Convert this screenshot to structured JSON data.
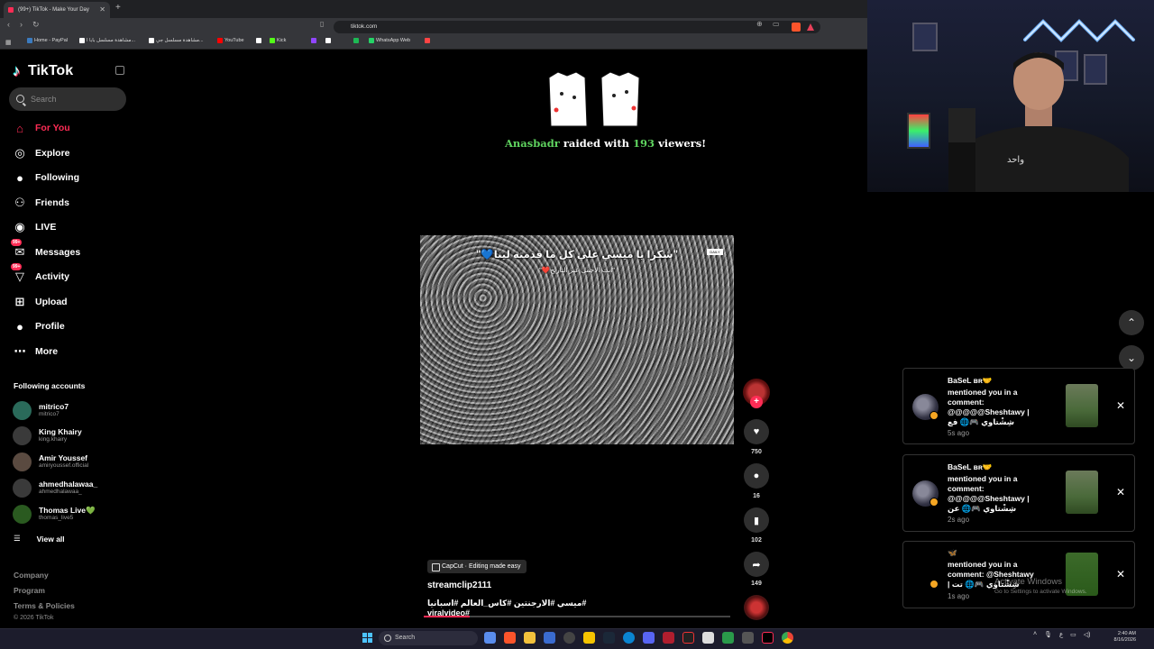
{
  "browser": {
    "tab_title": "(99+) TikTok - Make Your Day",
    "url": "tiktok.com",
    "bookmarks": [
      {
        "label": "Home - PayPal",
        "color": "#3b7bbf"
      },
      {
        "label": "مشاهدة مسلسل بابا ا...",
        "color": "#ffffff"
      },
      {
        "label": "مشاهدة مسلسل جي...",
        "color": "#ffffff"
      },
      {
        "label": "YouTube",
        "color": "#ff0000"
      },
      {
        "label": "",
        "color": "#ffffff"
      },
      {
        "label": "Kick",
        "color": "#53fc18"
      },
      {
        "label": "",
        "color": "#9146ff"
      },
      {
        "label": "",
        "color": "#ffffff"
      },
      {
        "label": "",
        "color": "#1db954"
      },
      {
        "label": "WhatsApp Web",
        "color": "#25d366"
      },
      {
        "label": "",
        "color": "#ff4444"
      }
    ]
  },
  "sidebar": {
    "logo": "TikTok",
    "search_placeholder": "Search",
    "nav": [
      {
        "label": "For You",
        "icon": "home-icon",
        "active": true
      },
      {
        "label": "Explore",
        "icon": "compass-icon"
      },
      {
        "label": "Following",
        "icon": "following-avatar-icon"
      },
      {
        "label": "Friends",
        "icon": "friends-icon"
      },
      {
        "label": "LIVE",
        "icon": "live-icon"
      },
      {
        "label": "Messages",
        "icon": "messages-icon",
        "badge": "99+"
      },
      {
        "label": "Activity",
        "icon": "activity-icon",
        "badge": "99+"
      },
      {
        "label": "Upload",
        "icon": "upload-icon"
      },
      {
        "label": "Profile",
        "icon": "profile-avatar-icon"
      },
      {
        "label": "More",
        "icon": "more-icon"
      }
    ],
    "following_title": "Following accounts",
    "accounts": [
      {
        "name": "mitrico7",
        "handle": "mitrico7"
      },
      {
        "name": "King Khairy",
        "handle": "king.khairy"
      },
      {
        "name": "Amir Youssef",
        "handle": "amiryoussef.official"
      },
      {
        "name": "ahmedhalawaa_",
        "handle": "ahmedhalawaa_"
      },
      {
        "name": "Thomas Live💚",
        "handle": "thomas_live5"
      }
    ],
    "view_all": "View all",
    "footer": [
      "Company",
      "Program",
      "Terms & Policies"
    ],
    "copyright": "© 2026 TikTok"
  },
  "raid": {
    "user": "Anasbadr",
    "mid": " raided with ",
    "count": "193",
    "tail": " viewers!"
  },
  "video": {
    "caption_line1": "\"شكرا يا ميسي علي كل ما قدمته لينا💙\"",
    "caption_line2": "\"انت الأجمل عبر التاريخ❤️\"",
    "watermark": "DAILY",
    "likes": "750",
    "comments": "16",
    "saves": "102",
    "shares": "149",
    "capcut": "CapCut · Editing made easy",
    "username": "streamclip2111",
    "hashtags": "#ميسي #الارجنتين #كاس_العالم #اسبانيا #viralvideo",
    "progress": 0.15
  },
  "notifications": [
    {
      "user": "BaSeL ʙʀ🤝",
      "text": "mentioned you in a comment: @@@@@Sheshtawy | شِشْتاوي 🎮🌐 فع",
      "time": "5s ago"
    },
    {
      "user": "BaSeL ʙʀ🤝",
      "text": "mentioned you in a comment: @@@@@Sheshtawy | شِشْتاوي 🎮🌐 عن",
      "time": "2s ago"
    },
    {
      "user": "🦋",
      "text": "mentioned you in a comment: @Sheshtawy | شِشْتاوي 🎮🌐 تت",
      "time": "1s ago"
    }
  ],
  "windows": {
    "activate_title": "Activate Windows",
    "activate_sub": "Go to Settings to activate Windows.",
    "search_placeholder": "Search",
    "time": "2:40 AM",
    "date": "8/16/2026",
    "lang": "ع"
  }
}
